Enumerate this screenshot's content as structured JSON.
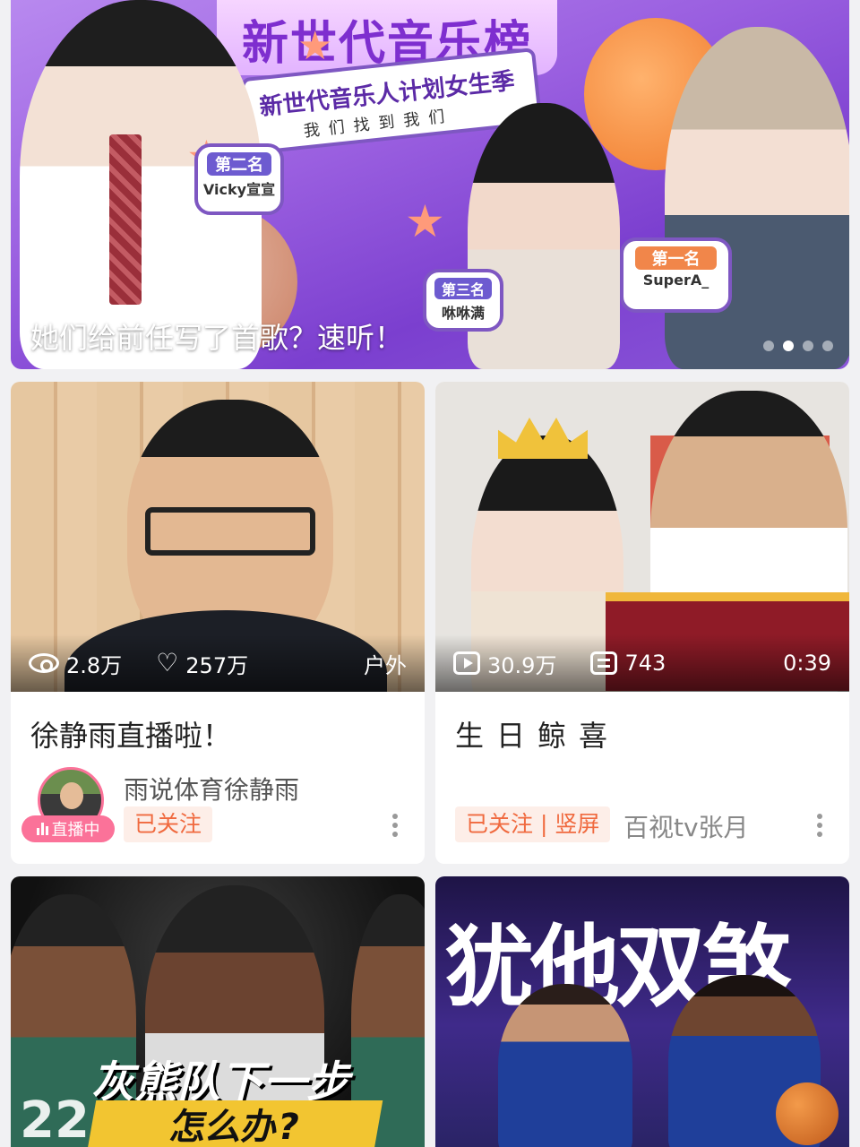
{
  "banner": {
    "title_art": "新世代音乐榜",
    "subtitle_line1": "新世代音乐人计划女生季",
    "subtitle_line2": "我们找到我们",
    "tags": [
      {
        "rank": "第二名",
        "name": "Vicky宣宣"
      },
      {
        "rank": "第三名",
        "name": "咻咻满"
      },
      {
        "rank": "第一名",
        "name": "SuperA_"
      }
    ],
    "caption": "她们给前任写了首歌？速听！",
    "dots": {
      "count": 4,
      "active_index": 1
    }
  },
  "feed": [
    {
      "views": "2.8万",
      "likes": "257万",
      "category": "户外",
      "title": "徐静雨直播啦！",
      "author": "雨说体育徐静雨",
      "live_badge": "直播中",
      "follow_label": "已关注"
    },
    {
      "plays": "30.9万",
      "danmaku": "743",
      "duration": "0:39",
      "title": "生日鲸喜",
      "follow_label": "已关注 | 竖屏",
      "author": "百视tv张月"
    },
    {
      "overlay_line1": "灰熊队下一步",
      "overlay_line2": "怎么办?",
      "jersey_text": "22"
    },
    {
      "overlay_title": "犹他双煞"
    }
  ],
  "colors": {
    "accent_pink": "#fb7299",
    "follow_orange": "#f06a3f",
    "follow_bg": "#fdeee8",
    "page_bg": "#f1f1f3"
  }
}
